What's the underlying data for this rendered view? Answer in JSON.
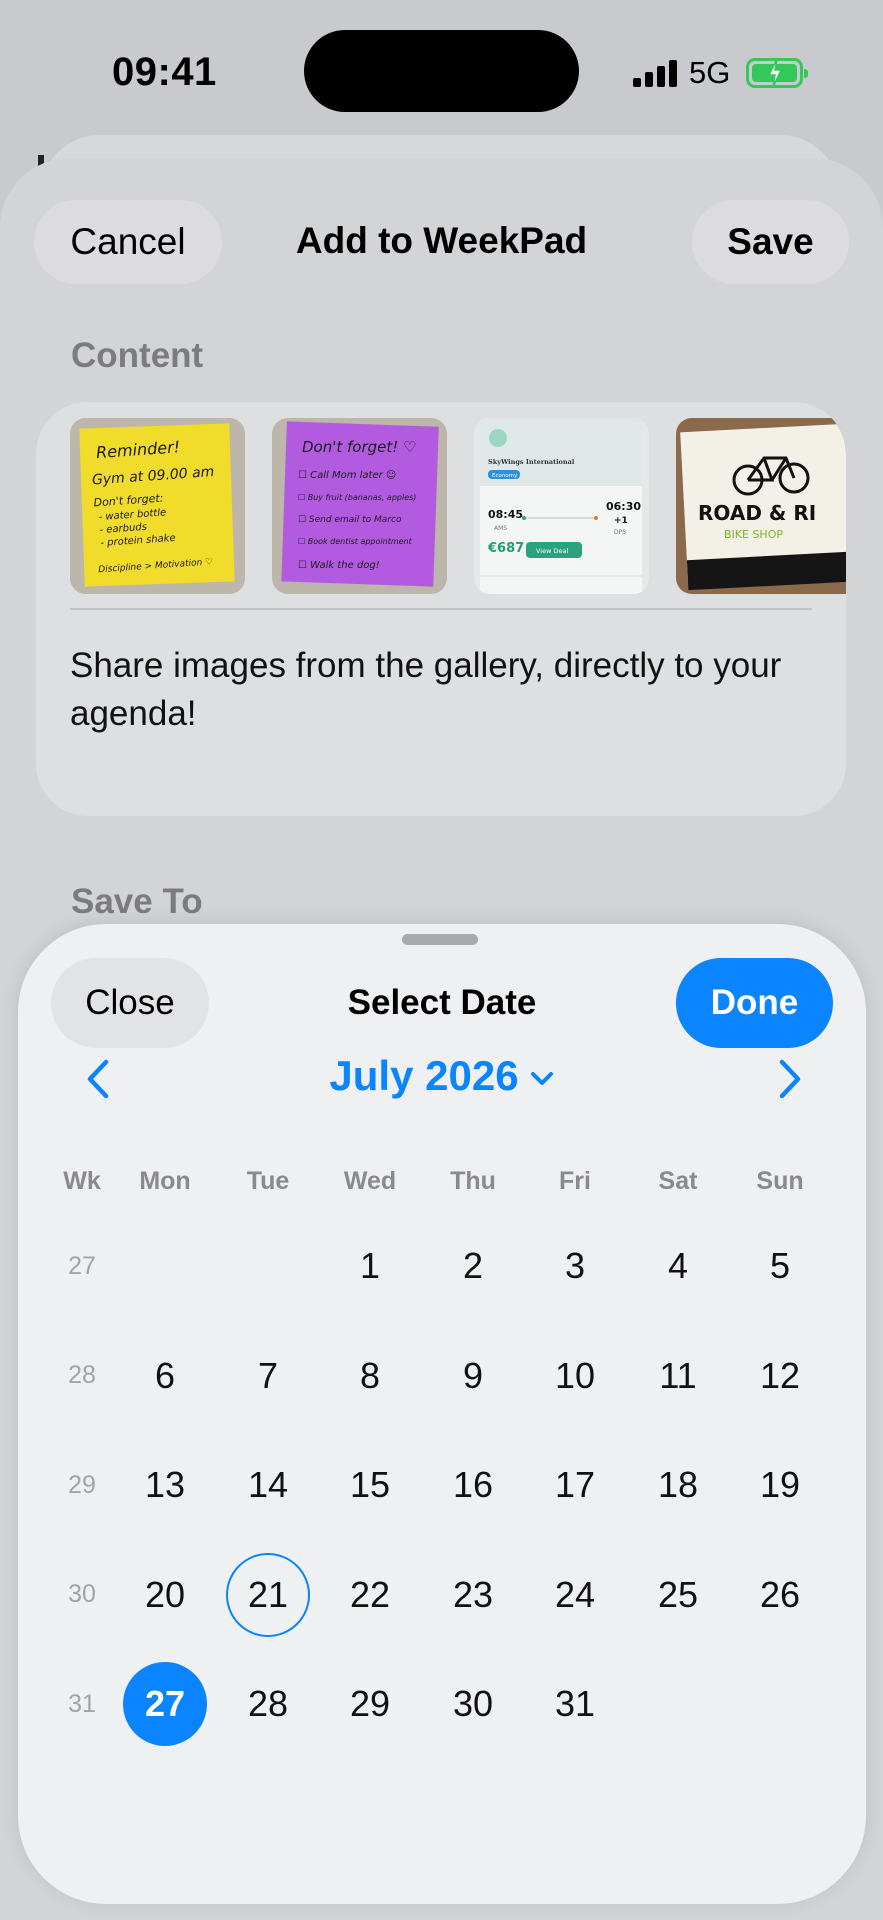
{
  "status_bar": {
    "time": "09:41",
    "network": "5G",
    "icons": [
      "signal-icon",
      "battery-charging-icon"
    ]
  },
  "sheet": {
    "cancel_label": "Cancel",
    "title": "Add to WeekPad",
    "save_label": "Save",
    "content_label": "Content",
    "content_text": "Share images from the gallery, directly to your agenda!",
    "save_to_label": "Save To",
    "thumbnails": [
      {
        "name": "yellow-sticky-note",
        "lines": [
          "Reminder!",
          "Gym at 09.00 am",
          "Don't forget:",
          "- water bottle",
          "- earbuds",
          "- protein shake",
          "Discipline > Motivation ♡"
        ]
      },
      {
        "name": "purple-sticky-note",
        "lines": [
          "Don't forget! ♡",
          "☐ Call Mom later ☺",
          "☐ Buy fruit (bananas, apples)",
          "☐ Send email to Marco",
          "☐ Book dentist appointment",
          "☐ Walk the dog!"
        ]
      },
      {
        "name": "flight-ticket",
        "airline": "SkyWings International",
        "class": "Economy",
        "dep_time": "08:45",
        "dep_code": "AMS",
        "arr_time": "06:30",
        "arr_plus": "+1",
        "arr_code": "DPS",
        "price": "€687",
        "cta": "View Deal"
      },
      {
        "name": "bike-shop-card",
        "title": "ROAD & RI",
        "subtitle": "BIKE SHOP"
      }
    ]
  },
  "picker": {
    "close_label": "Close",
    "title": "Select Date",
    "done_label": "Done",
    "month_label": "July 2026",
    "accent": "#0a84ff",
    "weekdays": [
      "Wk",
      "Mon",
      "Tue",
      "Wed",
      "Thu",
      "Fri",
      "Sat",
      "Sun"
    ],
    "weeks": [
      {
        "wk": "27",
        "days": [
          "",
          "",
          "1",
          "2",
          "3",
          "4",
          "5"
        ]
      },
      {
        "wk": "28",
        "days": [
          "6",
          "7",
          "8",
          "9",
          "10",
          "11",
          "12"
        ]
      },
      {
        "wk": "29",
        "days": [
          "13",
          "14",
          "15",
          "16",
          "17",
          "18",
          "19"
        ]
      },
      {
        "wk": "30",
        "days": [
          "20",
          "21",
          "22",
          "23",
          "24",
          "25",
          "26"
        ]
      },
      {
        "wk": "31",
        "days": [
          "27",
          "28",
          "29",
          "30",
          "31",
          "",
          ""
        ]
      }
    ],
    "today": "21",
    "selected": "27"
  }
}
